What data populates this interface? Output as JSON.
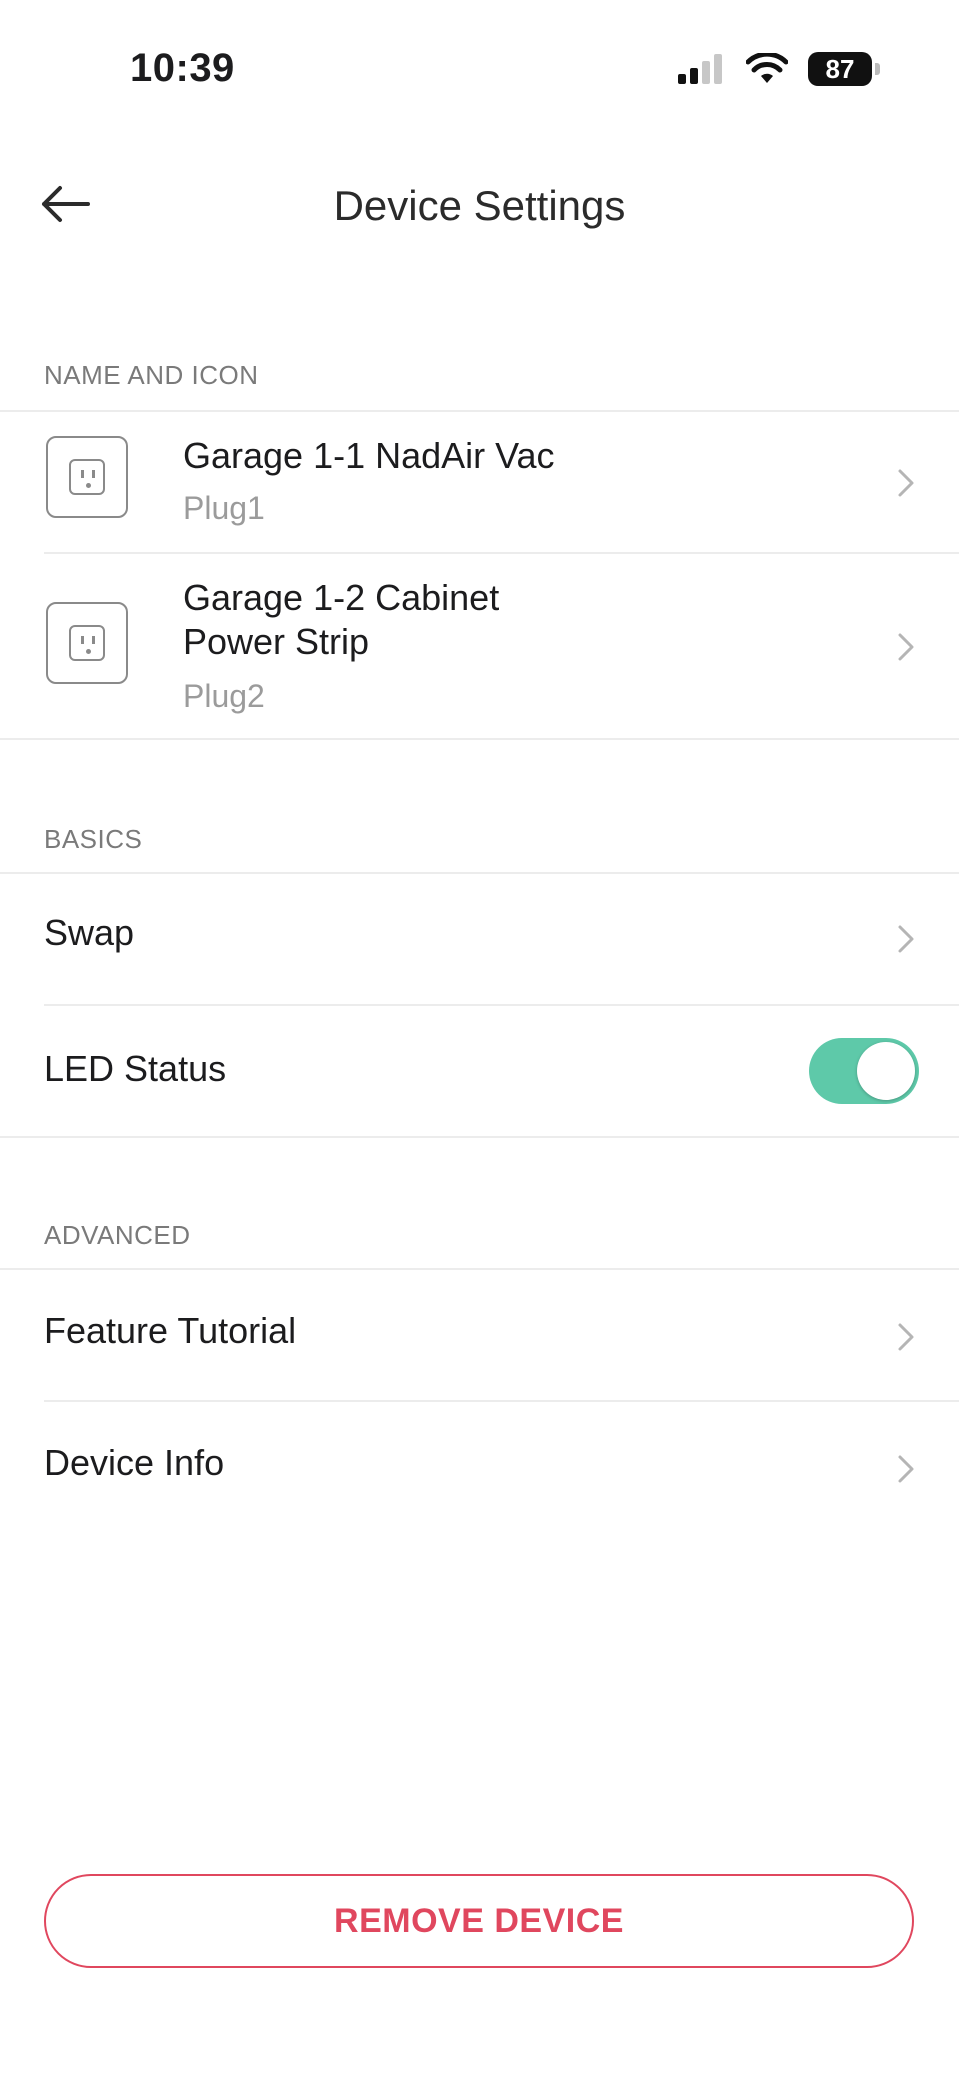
{
  "status_bar": {
    "time": "10:39",
    "battery": "87"
  },
  "header": {
    "title": "Device Settings"
  },
  "sections": {
    "name_and_icon": "NAME AND ICON",
    "basics": "BASICS",
    "advanced": "ADVANCED"
  },
  "devices": [
    {
      "name": "Garage 1-1 NadAir Vac",
      "plug": "Plug1"
    },
    {
      "name": "Garage 1-2 Cabinet\nPower Strip",
      "plug": "Plug2"
    }
  ],
  "basics": {
    "swap_label": "Swap",
    "led_status_label": "LED Status",
    "led_status_on": true
  },
  "advanced": {
    "feature_tutorial_label": "Feature Tutorial",
    "device_info_label": "Device Info"
  },
  "actions": {
    "remove_label": "REMOVE DEVICE"
  },
  "colors": {
    "accent_toggle": "#5ec9a9",
    "danger": "#e0475e"
  }
}
